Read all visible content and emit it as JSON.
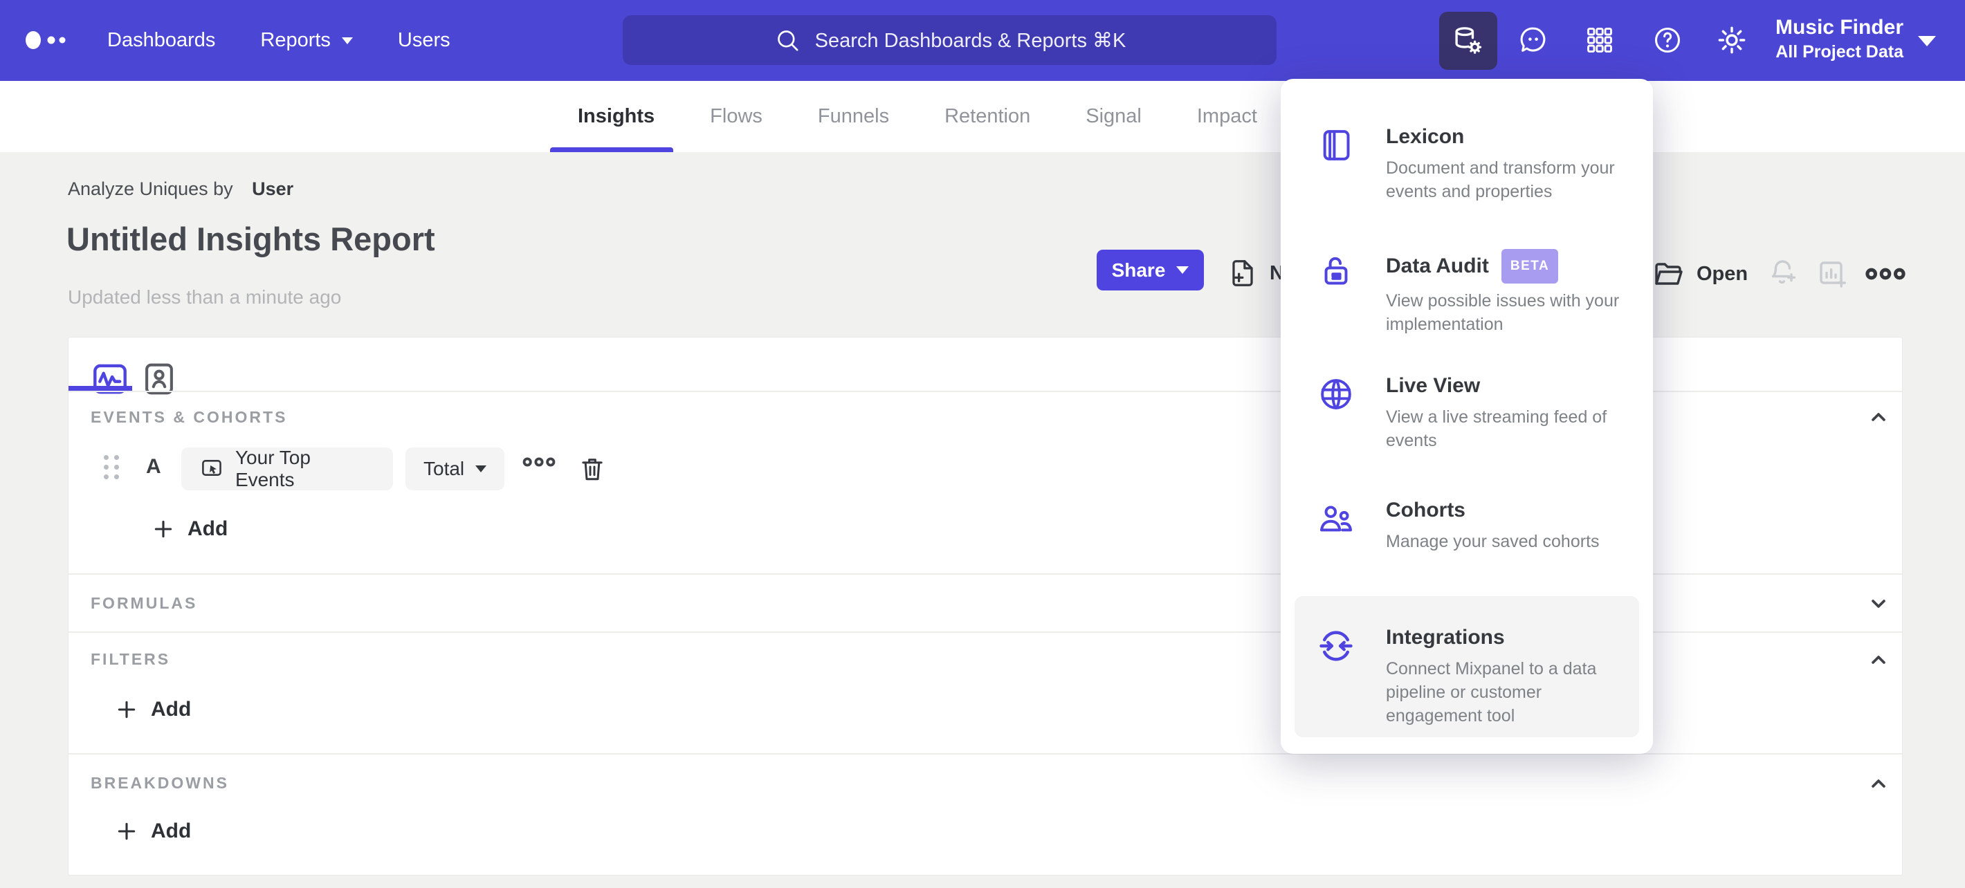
{
  "topnav": {
    "nav_items": [
      "Dashboards",
      "Reports",
      "Users"
    ],
    "search_placeholder": "Search Dashboards & Reports ⌘K",
    "project_name": "Music Finder",
    "project_scope": "All Project Data"
  },
  "tabs": {
    "items": [
      "Insights",
      "Flows",
      "Funnels",
      "Retention",
      "Signal",
      "Impact"
    ],
    "active": "Insights"
  },
  "report": {
    "analyze_label": "Analyze Uniques by",
    "analyze_value": "User",
    "title": "Untitled Insights Report",
    "updated": "Updated less than a minute ago",
    "share": "Share",
    "new": "New",
    "open": "Open"
  },
  "builder": {
    "events_label": "EVENTS & COHORTS",
    "row_letter": "A",
    "row_event": "Your Top Events",
    "row_aggregation": "Total",
    "add_label": "Add",
    "formulas_label": "FORMULAS",
    "filters_label": "FILTERS",
    "breakdowns_label": "BREAKDOWNS"
  },
  "menu": {
    "items": [
      {
        "title": "Lexicon",
        "desc": "Document and transform your events and properties"
      },
      {
        "title": "Data Audit",
        "badge": "BETA",
        "desc": "View possible issues with your implementation"
      },
      {
        "title": "Live View",
        "desc": "View a live streaming feed of events"
      },
      {
        "title": "Cohorts",
        "desc": "Manage your saved cohorts"
      },
      {
        "title": "Integrations",
        "desc": "Connect Mixpanel to a data pipeline or customer engagement tool"
      }
    ]
  },
  "colors": {
    "header_purple": "#4c46d5",
    "brand_purple": "#4f44e0",
    "active_tile": "#39336d",
    "beta_badge": "#a89cf0",
    "page_bg": "#f1f1ef",
    "highlight_gray": "#f4f4f4"
  }
}
